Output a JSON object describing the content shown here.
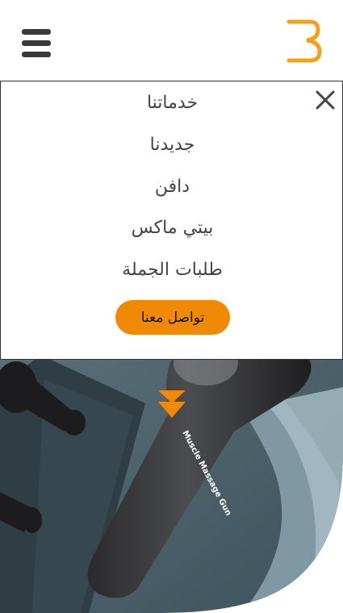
{
  "header": {
    "menu_icon": "hamburger-icon",
    "logo_icon": "brand-logo",
    "logo_color": "#f08a06"
  },
  "menu": {
    "close_icon": "close-icon",
    "items": [
      {
        "label": "خدماتنا"
      },
      {
        "label": "جديدنا"
      },
      {
        "label": "دافن"
      },
      {
        "label": "بيتي ماكس"
      },
      {
        "label": "طلبات الجملة"
      }
    ],
    "cta_label": "تواصل معنا",
    "cta_color": "#f08a06"
  },
  "hero": {
    "product_text": "Muscle Massage Gun",
    "scroll_icon": "double-chevron-down-icon"
  }
}
